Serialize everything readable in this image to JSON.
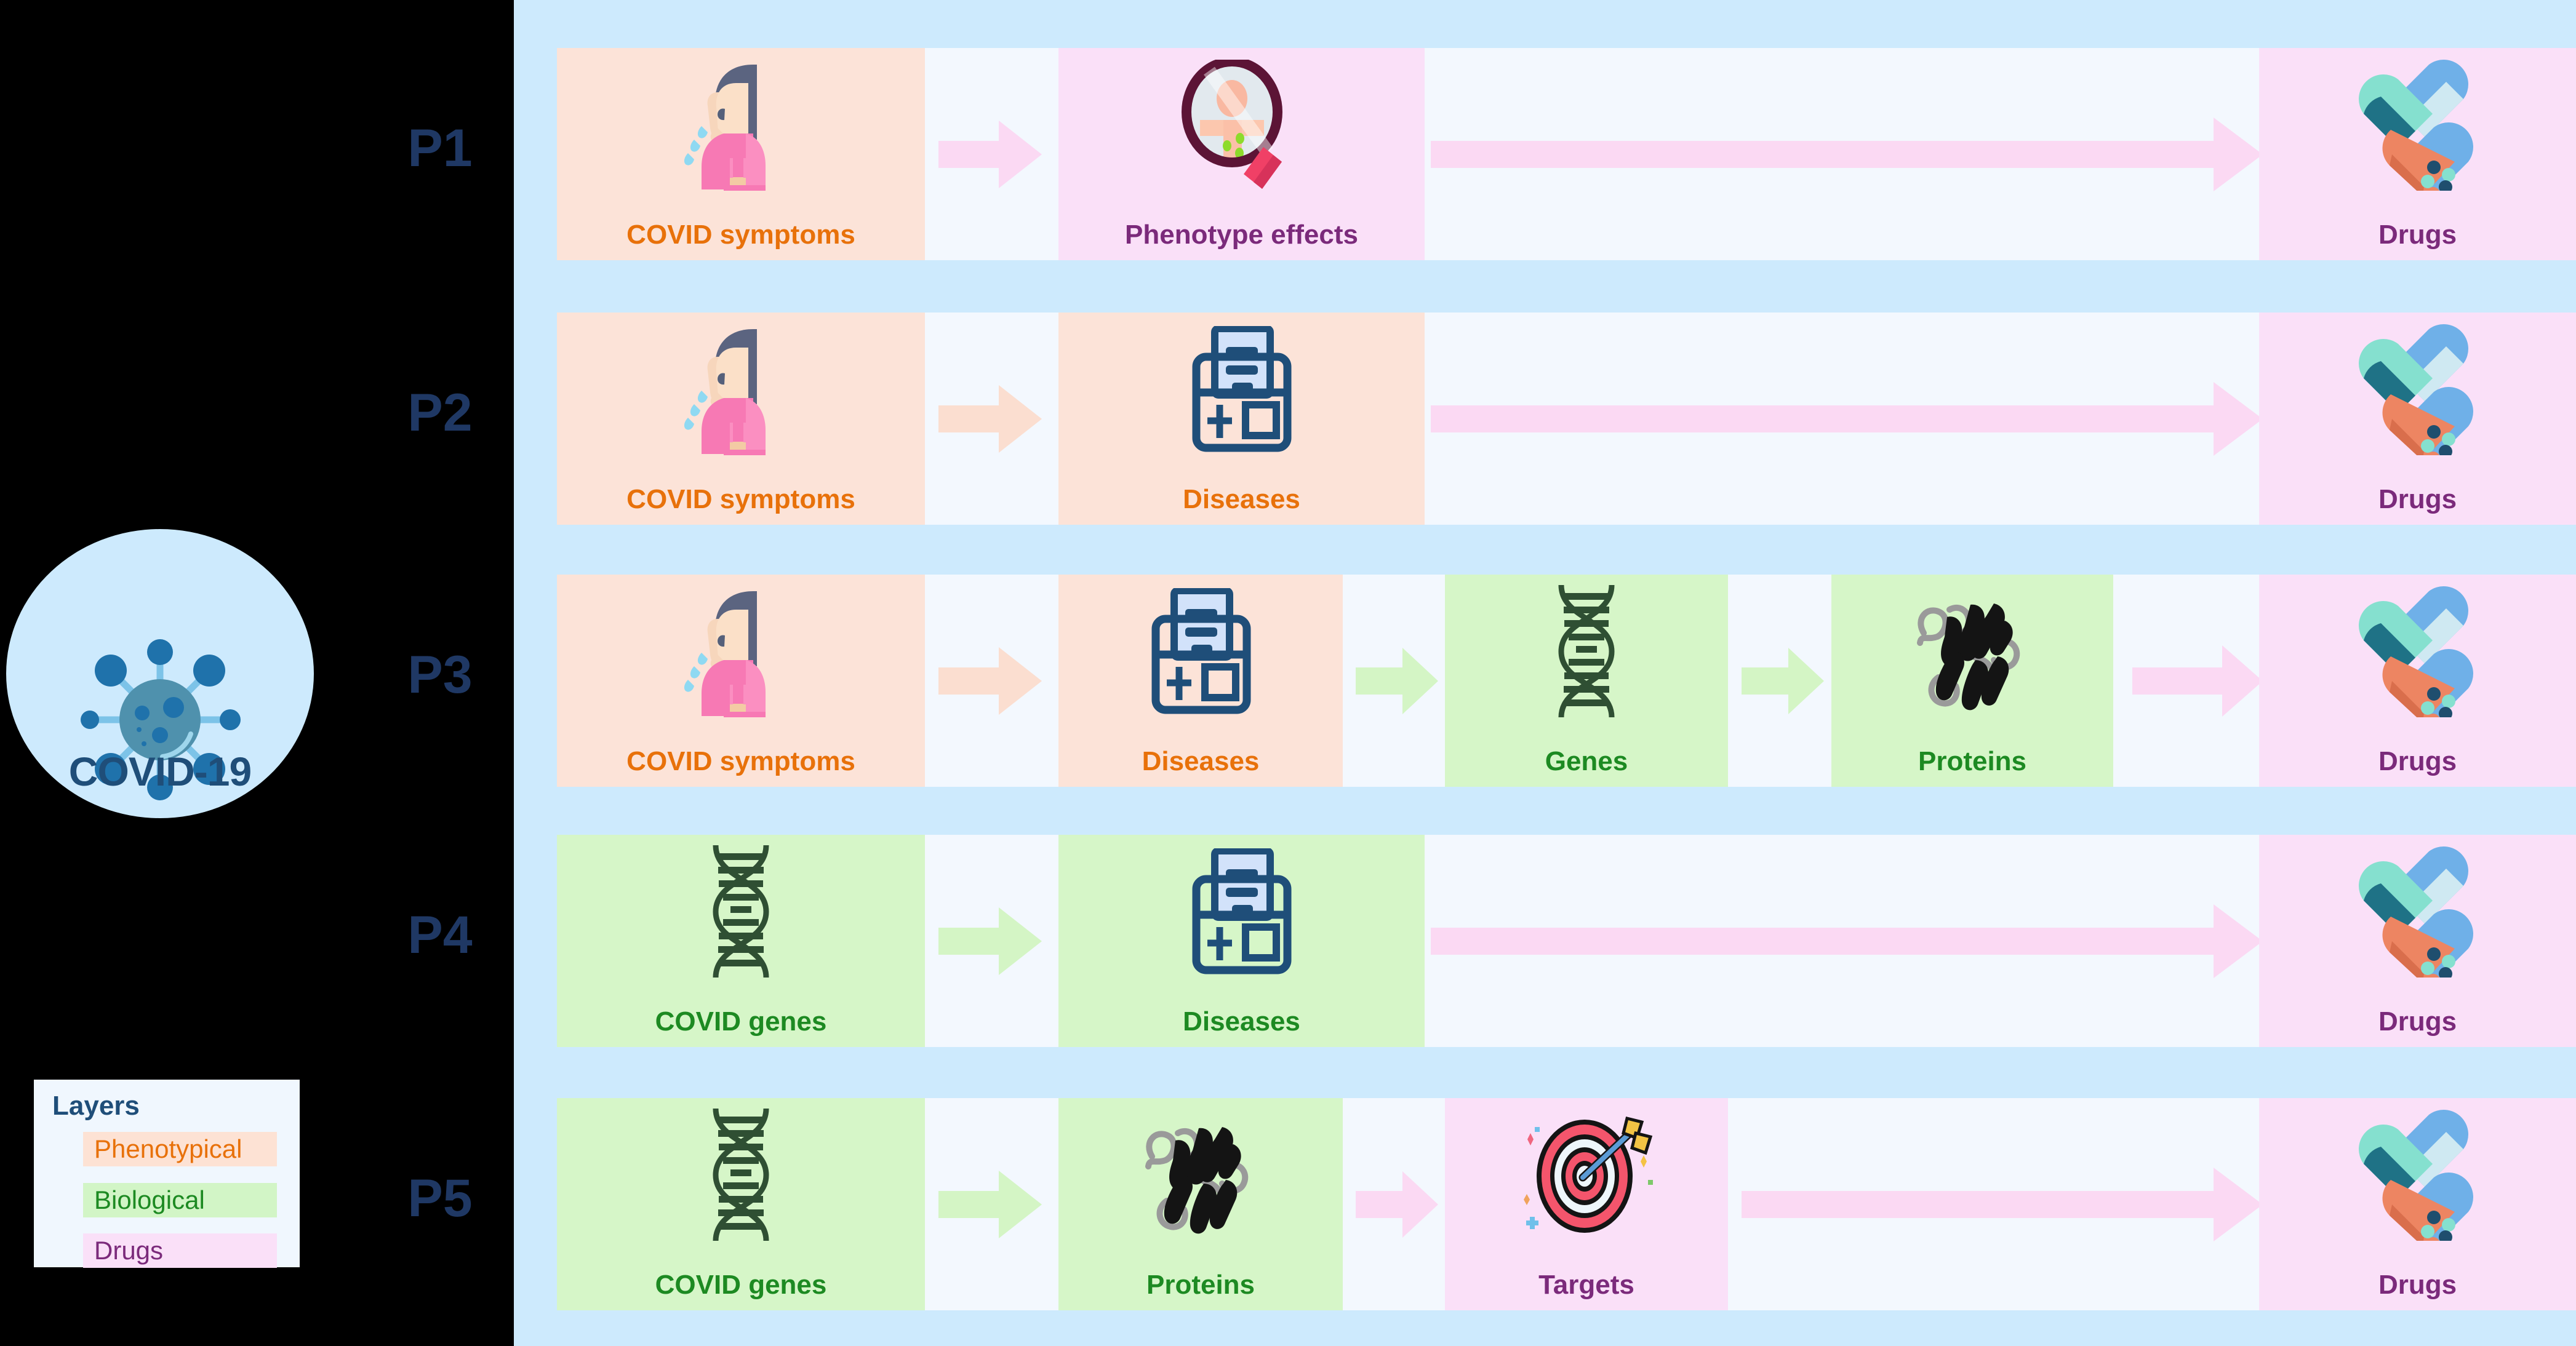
{
  "covid_badge": {
    "label": "COVID-19",
    "icon": "coronavirus-icon",
    "bg": "#cdeafd"
  },
  "legend": {
    "title": "Layers",
    "items": [
      {
        "label": "Phenotypical",
        "bg": "#fde2d4",
        "color": "#e8710a"
      },
      {
        "label": "Biological",
        "bg": "#d2f5c6",
        "color": "#1d8a22"
      },
      {
        "label": "Drugs",
        "bg": "#fae0f8",
        "color": "#7b2a7b"
      }
    ]
  },
  "paths": [
    {
      "id": "P1",
      "label": "P1",
      "nodes": [
        {
          "label": "COVID symptoms",
          "layer": "phenotypical",
          "icon": "sneezing-person-icon"
        },
        {
          "label": "Phenotype effects",
          "layer": "drugs",
          "icon": "magnifier-body-icon"
        },
        {
          "label": "Drugs",
          "layer": "drugs",
          "icon": "pills-capsules-icon"
        }
      ],
      "arrows": [
        "short-pink",
        "long-pink"
      ]
    },
    {
      "id": "P2",
      "label": "P2",
      "nodes": [
        {
          "label": "COVID symptoms",
          "layer": "phenotypical",
          "icon": "sneezing-person-icon"
        },
        {
          "label": "Diseases",
          "layer": "phenotypical",
          "icon": "medical-record-icon"
        },
        {
          "label": "Drugs",
          "layer": "drugs",
          "icon": "pills-capsules-icon"
        }
      ],
      "arrows": [
        "short-peach",
        "long-pink"
      ]
    },
    {
      "id": "P3",
      "label": "P3",
      "nodes": [
        {
          "label": "COVID symptoms",
          "layer": "phenotypical",
          "icon": "sneezing-person-icon"
        },
        {
          "label": "Diseases",
          "layer": "phenotypical",
          "icon": "medical-record-icon"
        },
        {
          "label": "Genes",
          "layer": "biological",
          "icon": "dna-helix-icon"
        },
        {
          "label": "Proteins",
          "layer": "biological",
          "icon": "protein-fold-icon"
        },
        {
          "label": "Drugs",
          "layer": "drugs",
          "icon": "pills-capsules-icon"
        }
      ],
      "arrows": [
        "short-peach",
        "short-green",
        "short-green",
        "long-pink"
      ]
    },
    {
      "id": "P4",
      "label": "P4",
      "nodes": [
        {
          "label": "COVID genes",
          "layer": "biological",
          "icon": "dna-helix-icon"
        },
        {
          "label": "Diseases",
          "layer": "biological",
          "icon": "medical-record-icon"
        },
        {
          "label": "Drugs",
          "layer": "drugs",
          "icon": "pills-capsules-icon"
        }
      ],
      "arrows": [
        "short-green",
        "long-pink"
      ]
    },
    {
      "id": "P5",
      "label": "P5",
      "nodes": [
        {
          "label": "COVID genes",
          "layer": "biological",
          "icon": "dna-helix-icon"
        },
        {
          "label": "Proteins",
          "layer": "biological",
          "icon": "protein-fold-icon"
        },
        {
          "label": "Targets",
          "layer": "drugs",
          "icon": "target-arrow-icon"
        },
        {
          "label": "Drugs",
          "layer": "drugs",
          "icon": "pills-capsules-icon"
        }
      ],
      "arrows": [
        "short-green",
        "short-pink",
        "long-pink"
      ]
    }
  ],
  "colors": {
    "background": "#000000",
    "panel": "#cdeafd",
    "gap": "#f3f8fe",
    "phenotypical_bg": "#fce3d8",
    "biological_bg": "#d6f6c8",
    "drugs_bg": "#fae0f8",
    "phenotypical_text": "#e8710a",
    "biological_text": "#1d8a22",
    "drugs_text": "#7b2a7b",
    "path_label": "#1f3864",
    "covid_text": "#1f4e79",
    "arrow_pink": "#fbd9f3",
    "arrow_peach": "#fbded0",
    "arrow_green": "#d4f5c5"
  }
}
